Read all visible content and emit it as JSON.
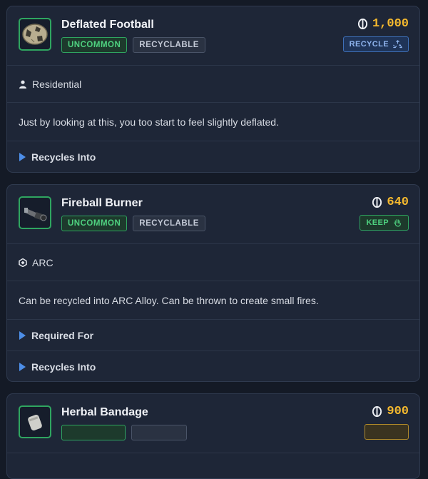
{
  "items": [
    {
      "name": "Deflated Football",
      "rarity": "UNCOMMON",
      "category": "RECYCLABLE",
      "price": "1,000",
      "action": "RECYCLE",
      "action_icon": "recycle-icon",
      "location": "Residential",
      "location_icon": "person-icon",
      "description": "Just by looking at this, you too start to feel slightly deflated.",
      "sections": [
        "Recycles Into"
      ]
    },
    {
      "name": "Fireball Burner",
      "rarity": "UNCOMMON",
      "category": "RECYCLABLE",
      "price": "640",
      "action": "KEEP",
      "action_icon": "hand-icon",
      "location": "ARC",
      "location_icon": "arc-icon",
      "description": "Can be recycled into ARC Alloy. Can be thrown to create small fires.",
      "sections": [
        "Required For",
        "Recycles Into"
      ]
    },
    {
      "name": "Herbal Bandage",
      "price": "900"
    }
  ],
  "colors": {
    "rarity_uncommon": "#4ed07f",
    "price": "#f5b92e",
    "recycle": "#8fb4ee",
    "keep": "#4ed07f"
  }
}
